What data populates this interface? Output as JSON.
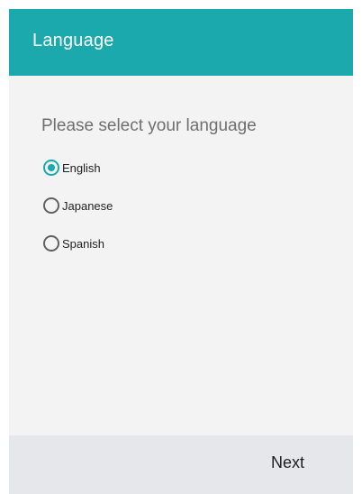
{
  "app_bar": {
    "title": "Language"
  },
  "content": {
    "prompt": "Please select your language",
    "options": [
      {
        "label": "English",
        "selected": true
      },
      {
        "label": "Japanese",
        "selected": false
      },
      {
        "label": "Spanish",
        "selected": false
      }
    ]
  },
  "footer": {
    "next_label": "Next"
  },
  "colors": {
    "accent": "#1ba9ad",
    "background": "#f3f3f3",
    "footer": "#e5e7ea"
  }
}
